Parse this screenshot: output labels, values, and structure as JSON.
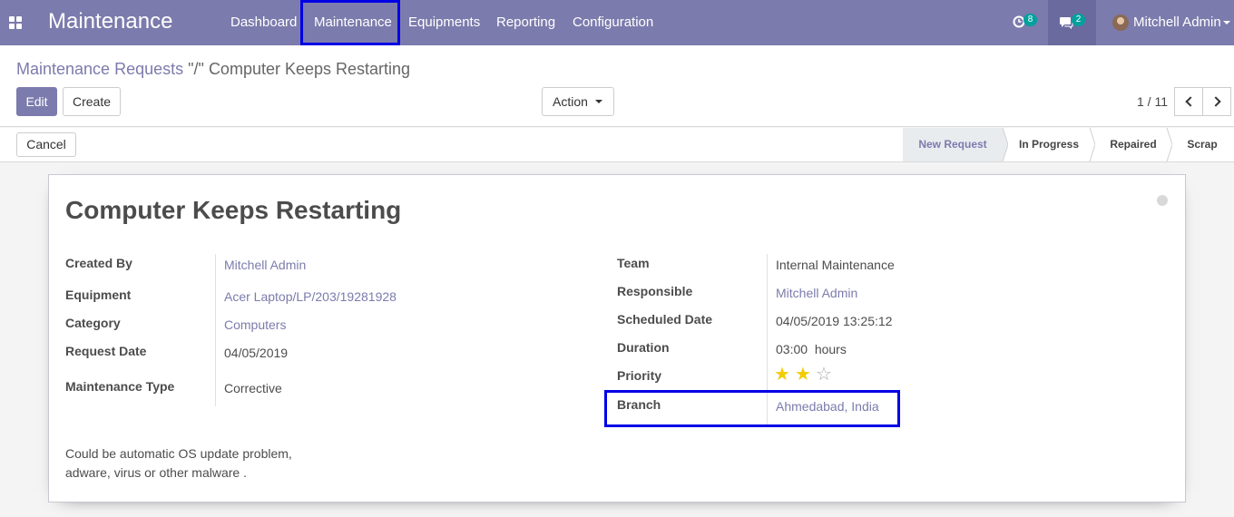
{
  "navbar": {
    "brand": "Maintenance",
    "menu": [
      "Dashboard",
      "Maintenance",
      "Equipments",
      "Reporting",
      "Configuration"
    ],
    "activity_count": "8",
    "message_count": "2",
    "user_name": "Mitchell Admin"
  },
  "breadcrumb": {
    "parent": "Maintenance Requests",
    "separator": "\"/\"",
    "current": "Computer Keeps Restarting"
  },
  "buttons": {
    "edit": "Edit",
    "create": "Create",
    "action": "Action",
    "cancel": "Cancel"
  },
  "pager": {
    "value": "1 / 11"
  },
  "stages": [
    "New Request",
    "In Progress",
    "Repaired",
    "Scrap"
  ],
  "active_stage": "New Request",
  "record": {
    "title": "Computer Keeps Restarting",
    "left_fields": [
      {
        "label": "Created By",
        "value": "Mitchell Admin"
      },
      {
        "label": "Equipment",
        "value": "Acer Laptop/LP/203/19281928"
      },
      {
        "label": "Category",
        "value": "Computers"
      },
      {
        "label": "Request Date",
        "value": "04/05/2019"
      },
      {
        "label": "Maintenance Type",
        "value": "Corrective"
      }
    ],
    "right_fields": [
      {
        "label": "Team",
        "value": "Internal Maintenance"
      },
      {
        "label": "Responsible",
        "value": "Mitchell Admin"
      },
      {
        "label": "Scheduled Date",
        "value": "04/05/2019 13:25:12"
      },
      {
        "label": "Duration",
        "value": "03:00  hours"
      },
      {
        "label": "Priority",
        "value": ""
      },
      {
        "label": "Branch",
        "value": "Ahmedabad, India"
      }
    ],
    "priority_stars": 2,
    "priority_max": 3,
    "description_lines": [
      "Could be automatic OS update problem,",
      "adware, virus or other malware ."
    ]
  },
  "colors": {
    "brand": "#7c7bad",
    "highlight": "#0000e6",
    "badge": "#00a09d",
    "star": "#f3cc00"
  }
}
